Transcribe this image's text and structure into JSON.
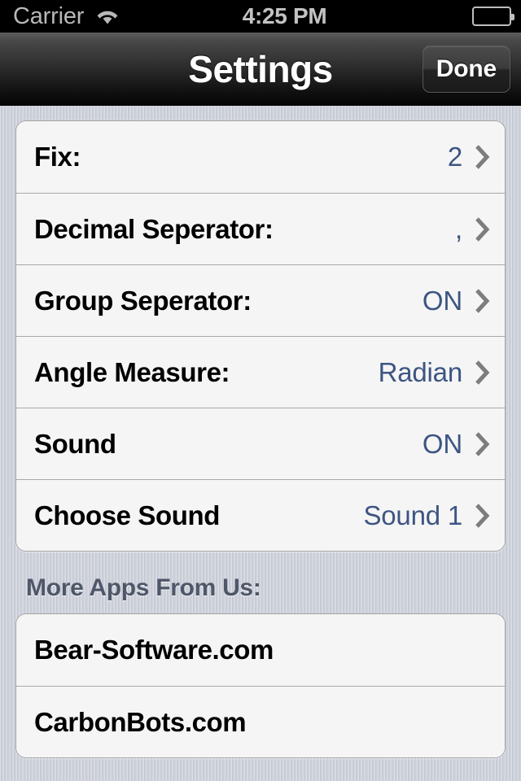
{
  "statusbar": {
    "carrier": "Carrier",
    "wifi_icon": "wifi-icon",
    "time": "4:25 PM",
    "battery_icon": "battery-full-icon"
  },
  "navbar": {
    "title": "Settings",
    "done_label": "Done"
  },
  "settings_group": {
    "rows": [
      {
        "label": "Fix:",
        "value": "2",
        "accessory": "chevron-right-icon"
      },
      {
        "label": "Decimal Seperator:",
        "value": ",",
        "accessory": "chevron-right-icon"
      },
      {
        "label": "Group Seperator:",
        "value": "ON",
        "accessory": "chevron-right-icon"
      },
      {
        "label": "Angle Measure:",
        "value": "Radian",
        "accessory": "chevron-right-icon"
      },
      {
        "label": "Sound",
        "value": "ON",
        "accessory": "chevron-right-icon"
      },
      {
        "label": "Choose Sound",
        "value": "Sound 1",
        "accessory": "chevron-right-icon"
      }
    ]
  },
  "more_apps": {
    "header": "More Apps From Us:",
    "rows": [
      {
        "label": "Bear-Software.com"
      },
      {
        "label": "CarbonBots.com"
      }
    ]
  },
  "colors": {
    "page_background": "#c9cdd7",
    "cell_background": "#f5f5f5",
    "value_text": "#3d5583",
    "label_text": "#000000",
    "section_header_text": "#4f5769",
    "separator": "#a8a8a8",
    "navbar_top": "#5e5e5e",
    "navbar_bottom": "#050505",
    "statusbar_background": "#000000",
    "statusbar_text": "#bdbdbd"
  }
}
